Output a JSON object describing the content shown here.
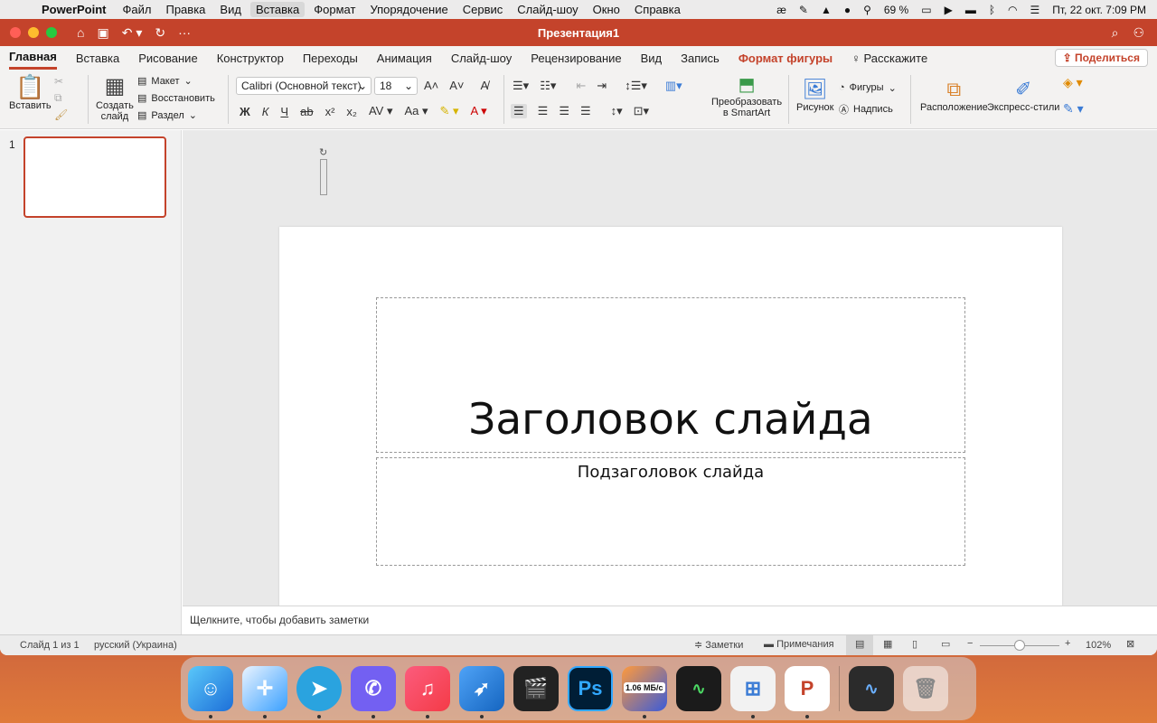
{
  "menubar": {
    "app": "PowerPoint",
    "items": [
      "Файл",
      "Правка",
      "Вид",
      "Вставка",
      "Формат",
      "Упорядочение",
      "Сервис",
      "Слайд-шоу",
      "Окно",
      "Справка"
    ],
    "battery": "69 %",
    "datetime": "Пт, 22 окт.  7:09 PM"
  },
  "window": {
    "title": "Презентация1"
  },
  "tabs": [
    "Главная",
    "Вставка",
    "Рисование",
    "Конструктор",
    "Переходы",
    "Анимация",
    "Слайд-шоу",
    "Рецензирование",
    "Вид",
    "Запись",
    "Формат фигуры",
    "Расскажите"
  ],
  "share": "Поделиться",
  "ribbon": {
    "paste": "Вставить",
    "new_slide_1": "Создать",
    "new_slide_2": "слайд",
    "layout": "Макет",
    "reset": "Восстановить",
    "section": "Раздел",
    "font": "Calibri (Основной текст)",
    "size": "18",
    "bold": "Ж",
    "italic": "К",
    "underline": "Ч",
    "strike": "ab",
    "smartart_1": "Преобразовать",
    "smartart_2": "в SmartArt",
    "picture": "Рисунок",
    "shapes": "Фигуры",
    "textbox": "Надпись",
    "arrange": "Расположение",
    "styles": "Экспресс-стили"
  },
  "thumb": {
    "number": "1"
  },
  "slide": {
    "title": "Заголовок слайда",
    "subtitle": "Подзаголовок слайда"
  },
  "notes": "Щелкните, чтобы добавить заметки",
  "status": {
    "slide": "Слайд 1 из 1",
    "lang": "русский (Украина)",
    "notes": "Заметки",
    "comments": "Примечания",
    "zoom": "102%"
  },
  "dock": {
    "net_speed": "1.06 МБ/с"
  },
  "colors": {
    "accent": "#c4432b"
  }
}
